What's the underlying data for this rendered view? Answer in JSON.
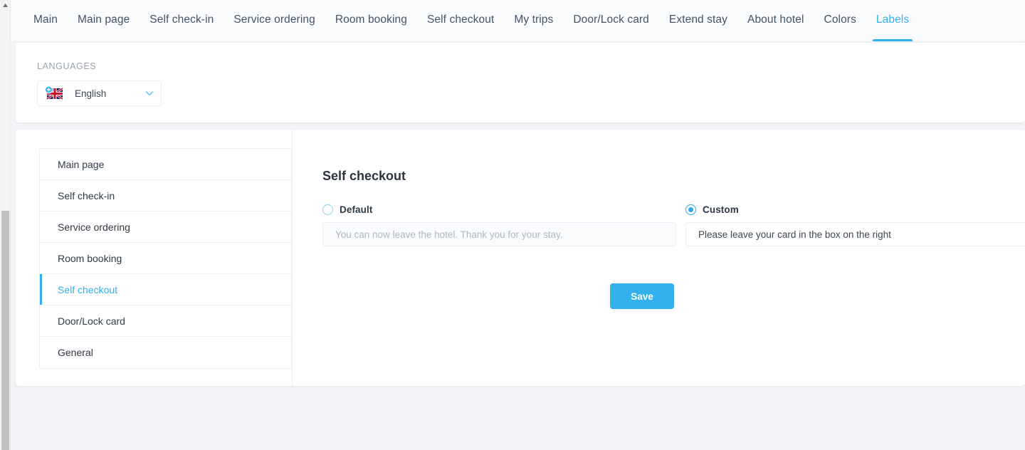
{
  "tabs": [
    {
      "label": "Main",
      "active": false
    },
    {
      "label": "Main page",
      "active": false
    },
    {
      "label": "Self check-in",
      "active": false
    },
    {
      "label": "Service ordering",
      "active": false
    },
    {
      "label": "Room booking",
      "active": false
    },
    {
      "label": "Self checkout",
      "active": false
    },
    {
      "label": "My trips",
      "active": false
    },
    {
      "label": "Door/Lock card",
      "active": false
    },
    {
      "label": "Extend stay",
      "active": false
    },
    {
      "label": "About hotel",
      "active": false
    },
    {
      "label": "Colors",
      "active": false
    },
    {
      "label": "Labels",
      "active": true
    }
  ],
  "languages": {
    "section_label": "LANGUAGES",
    "selected": "English",
    "flag_icon": "uk-flag-icon",
    "badge_icon": "add-badge-icon",
    "chevron_icon": "chevron-down-icon"
  },
  "sidebar": {
    "items": [
      {
        "label": "Main page",
        "active": false
      },
      {
        "label": "Self check-in",
        "active": false
      },
      {
        "label": "Service ordering",
        "active": false
      },
      {
        "label": "Room booking",
        "active": false
      },
      {
        "label": "Self checkout",
        "active": true
      },
      {
        "label": "Door/Lock card",
        "active": false
      },
      {
        "label": "General",
        "active": false
      }
    ]
  },
  "panel": {
    "title": "Self checkout",
    "default": {
      "radio_label": "Default",
      "selected": false,
      "value": "",
      "placeholder": "You can now leave the hotel. Thank you for your stay.",
      "disabled": true
    },
    "custom": {
      "radio_label": "Custom",
      "selected": true,
      "value": "Please leave your card in the box on the right",
      "placeholder": "",
      "disabled": false
    },
    "save_label": "Save"
  },
  "colors": {
    "accent": "#33b1ec",
    "page_background": "#f2f4f7",
    "card_background": "#ffffff",
    "tabbar_background": "#fafbfc",
    "text": "#2f3a46",
    "muted_text": "#aeb6c6"
  }
}
